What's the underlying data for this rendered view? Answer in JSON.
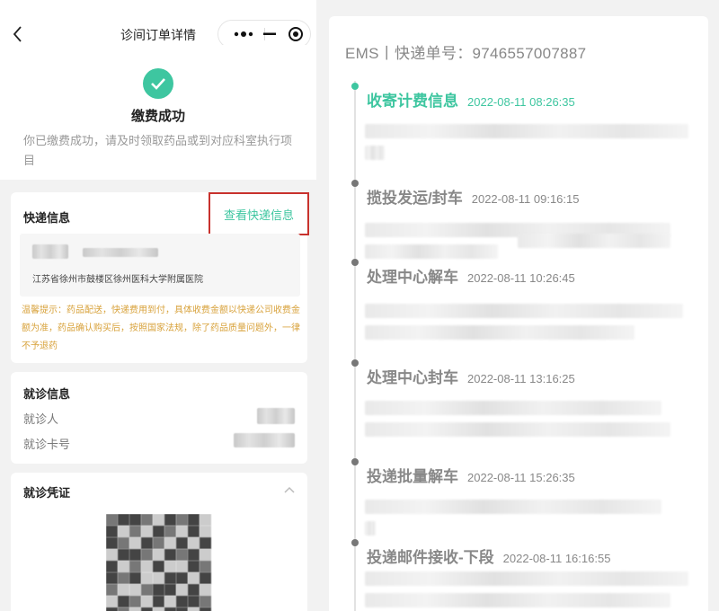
{
  "nav": {
    "title": "诊间订单详情"
  },
  "payment": {
    "title": "缴费成功",
    "description": "你已缴费成功，请及时领取药品或到对应科室执行项目"
  },
  "express_card": {
    "title": "快递信息",
    "view_button": "查看快递信息",
    "address": "江苏省徐州市鼓楼区徐州医科大学附属医院",
    "tip": "温馨提示：药品配送，快递费用到付，具体收费金额以快递公司收费金额为准，药品确认购买后，按照国家法规，除了药品质量问题外，一律不予退药"
  },
  "visit_info": {
    "title": "就诊信息",
    "patient_label": "就诊人",
    "card_label": "就诊卡号"
  },
  "visit_voucher": {
    "title": "就诊凭证"
  },
  "tracking": {
    "header": "EMS丨快递单号：9746557007887",
    "events": [
      {
        "status": "收寄计费信息",
        "time": "2022-08-11 08:26:35",
        "active": true
      },
      {
        "status": "揽投发运/封车",
        "time": "2022-08-11 09:16:15",
        "active": false
      },
      {
        "status": "处理中心解车",
        "time": "2022-08-11 10:26:45",
        "active": false
      },
      {
        "status": "处理中心封车",
        "time": "2022-08-11 13:16:25",
        "active": false
      },
      {
        "status": "投递批量解车",
        "time": "2022-08-11 15:26:35",
        "active": false
      },
      {
        "status": "投递邮件接收-下段",
        "time": "2022-08-11 16:16:55",
        "active": false
      }
    ]
  },
  "colors": {
    "accent": "#3ec6a0",
    "highlight_border": "#c8322d",
    "tip": "#d8a23b"
  },
  "icons": [
    "back-icon",
    "more-icon",
    "minimize-icon",
    "close-target-icon",
    "check-icon",
    "chevron-up-icon"
  ]
}
